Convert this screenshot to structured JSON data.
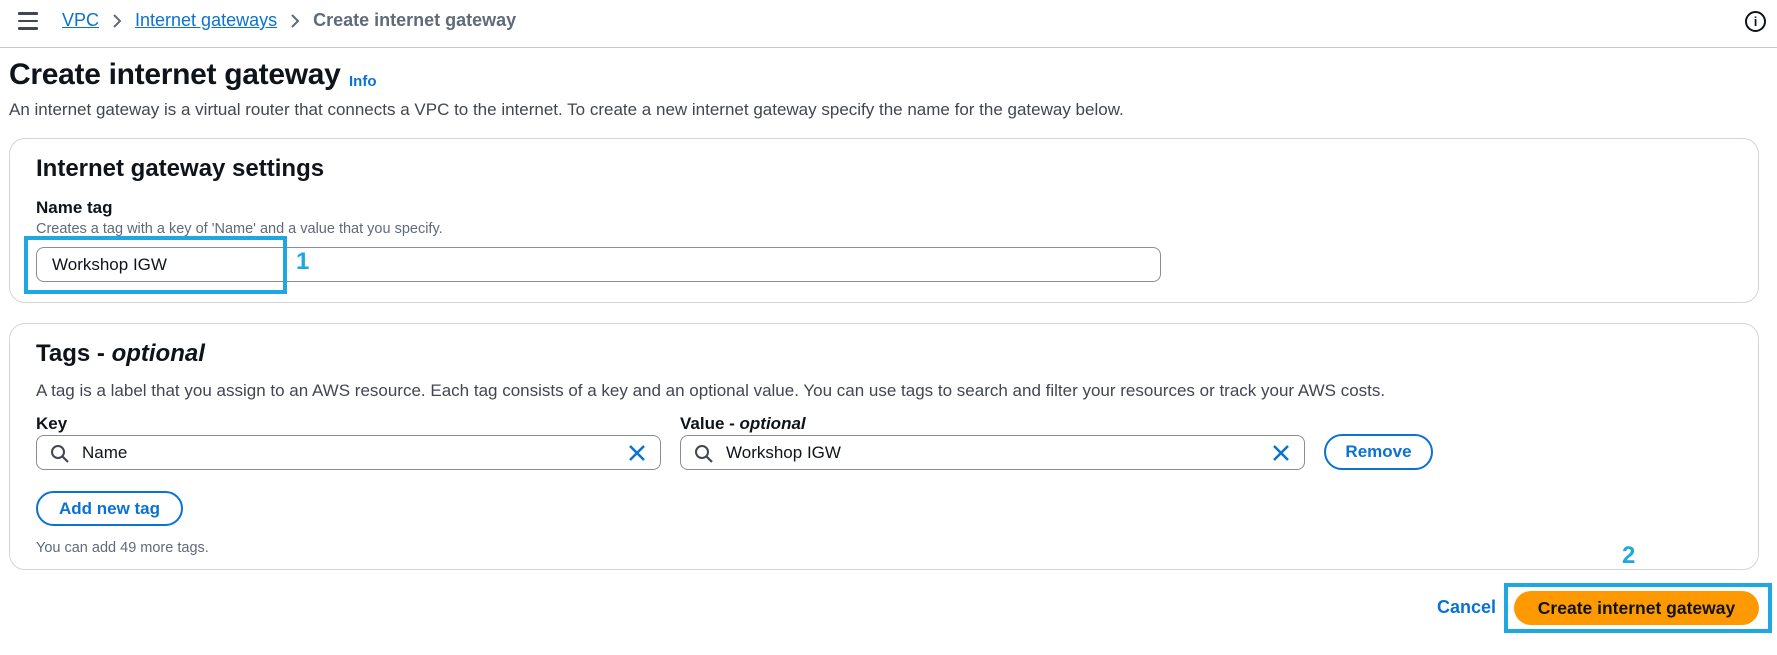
{
  "breadcrumb": {
    "items": [
      "VPC",
      "Internet gateways"
    ],
    "current": "Create internet gateway"
  },
  "header": {
    "title": "Create internet gateway",
    "info_link": "Info",
    "description": "An internet gateway is a virtual router that connects a VPC to the internet. To create a new internet gateway specify the name for the gateway below."
  },
  "settings": {
    "title": "Internet gateway settings",
    "name_tag_label": "Name tag",
    "name_tag_hint": "Creates a tag with a key of 'Name' and a value that you specify.",
    "name_tag_value": "Workshop IGW"
  },
  "tags": {
    "title_main": "Tags - ",
    "title_optional": "optional",
    "description": "A tag is a label that you assign to an AWS resource. Each tag consists of a key and an optional value. You can use tags to search and filter your resources or track your AWS costs.",
    "key_label": "Key",
    "value_label_main": "Value - ",
    "value_label_optional": "optional",
    "rows": [
      {
        "key": "Name",
        "value": "Workshop IGW"
      }
    ],
    "remove_label": "Remove",
    "add_label": "Add new tag",
    "remaining_hint": "You can add 49 more tags."
  },
  "footer": {
    "cancel_label": "Cancel",
    "submit_label": "Create internet gateway"
  },
  "annotations": {
    "step1": "1",
    "step2": "2"
  },
  "icons": {
    "menu": "hamburger-menu-icon",
    "chevron": "chevron-right-icon",
    "info": "info-circle-icon",
    "search": "search-icon",
    "clear": "close-x-icon"
  },
  "colors": {
    "link": "#0972d3",
    "primary_button": "#ff9900",
    "annotation": "#1ea7e1",
    "text": "#0f141a"
  }
}
